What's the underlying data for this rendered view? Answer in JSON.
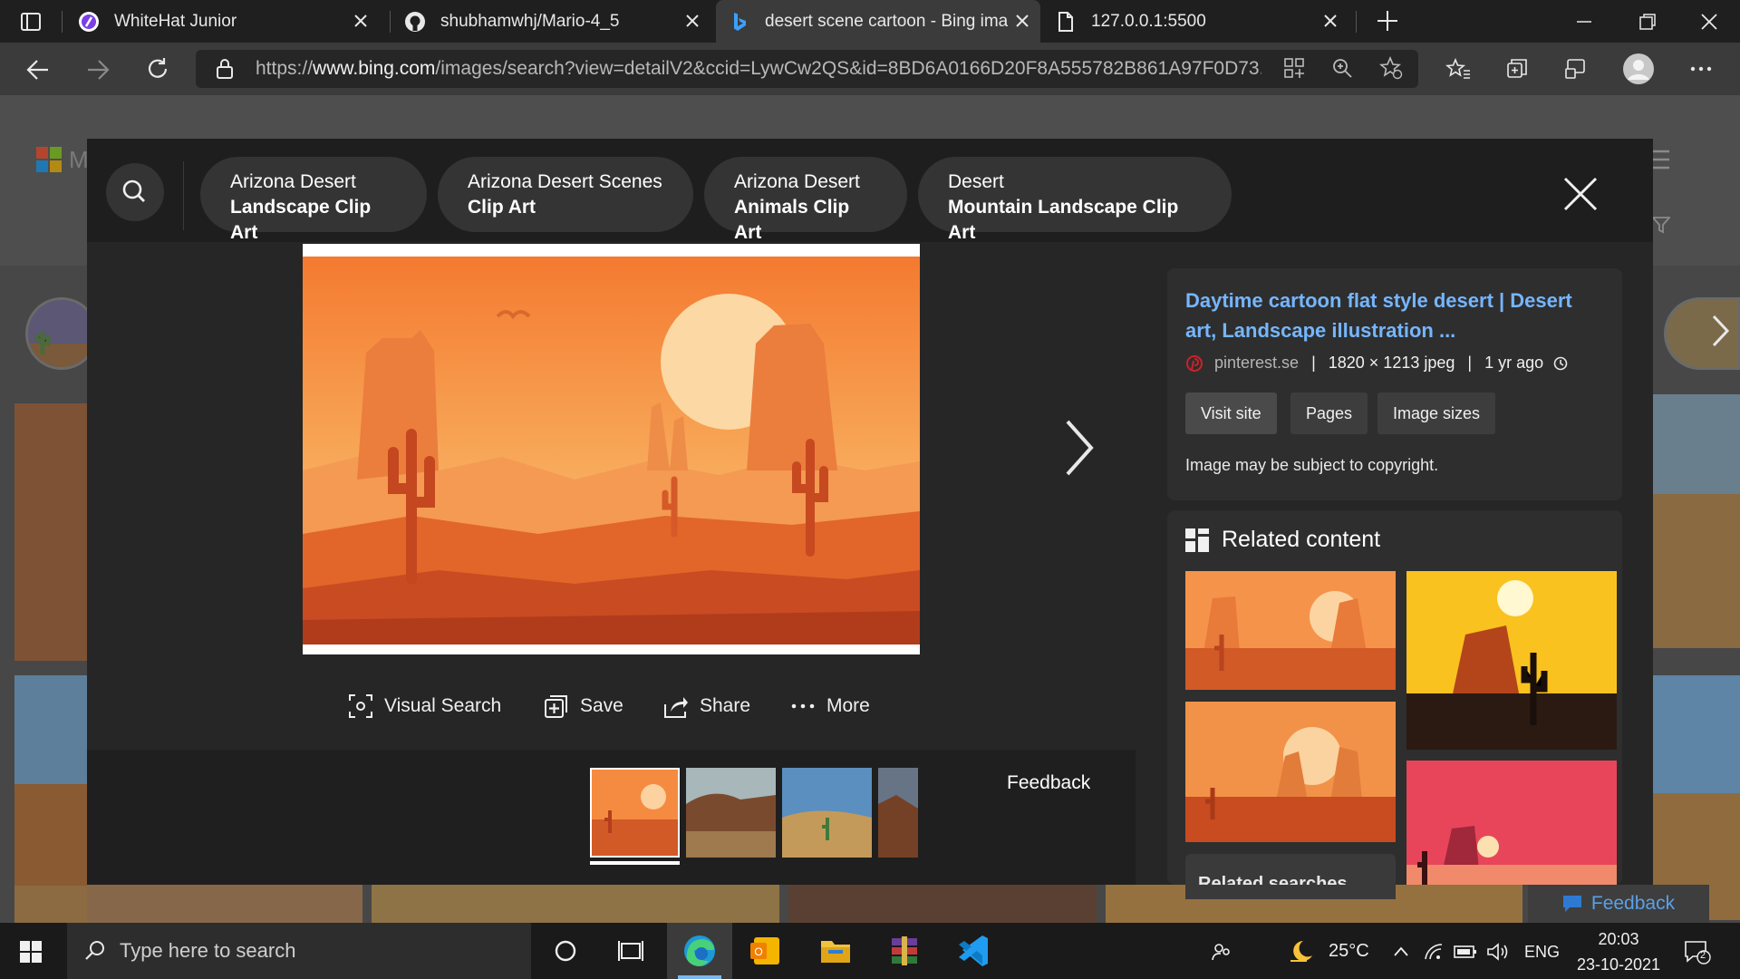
{
  "browser": {
    "tabs": [
      {
        "title": "WhiteHat Junior"
      },
      {
        "title": "shubhamwhj/Mario-4_5"
      },
      {
        "title": "desert scene cartoon - Bing imag"
      },
      {
        "title": "127.0.0.1:5500"
      }
    ],
    "url_prefix": "https://",
    "url_domain": "www.bing.com",
    "url_rest": "/images/search?view=detailV2&ccid=LywCw2QS&id=8BD6A0166D20F8A555782B861A97F0D73..."
  },
  "bing_logo_letter": "M",
  "related_pills": [
    {
      "line1": "Arizona Desert",
      "line2": "Landscape Clip Art"
    },
    {
      "line1": "Arizona Desert Scenes",
      "line2": "Clip Art"
    },
    {
      "line1": "Arizona Desert",
      "line2": "Animals Clip Art"
    },
    {
      "line1": "Desert",
      "line2": "Mountain Landscape Clip Art"
    }
  ],
  "actions": {
    "visual_search": "Visual Search",
    "save": "Save",
    "share": "Share",
    "more": "More"
  },
  "feedback_label": "Feedback",
  "details": {
    "title": "Daytime cartoon flat style desert | Desert art, Landscape illustration ...",
    "source": "pinterest.se",
    "dimensions": "1820 × 1213 jpeg",
    "age": "1 yr ago",
    "buttons": {
      "visit": "Visit site",
      "pages": "Pages",
      "sizes": "Image sizes"
    },
    "copyright": "Image may be subject to copyright."
  },
  "related": {
    "heading": "Related content",
    "searches_label": "Related searches"
  },
  "page_feedback": "Feedback",
  "taskbar": {
    "search_placeholder": "Type here to search",
    "temperature": "25°C",
    "language": "ENG",
    "time": "20:03",
    "date": "23-10-2021",
    "notifications": "2"
  },
  "colors": {
    "link": "#75b6ff",
    "accent": "#f07a2f"
  }
}
